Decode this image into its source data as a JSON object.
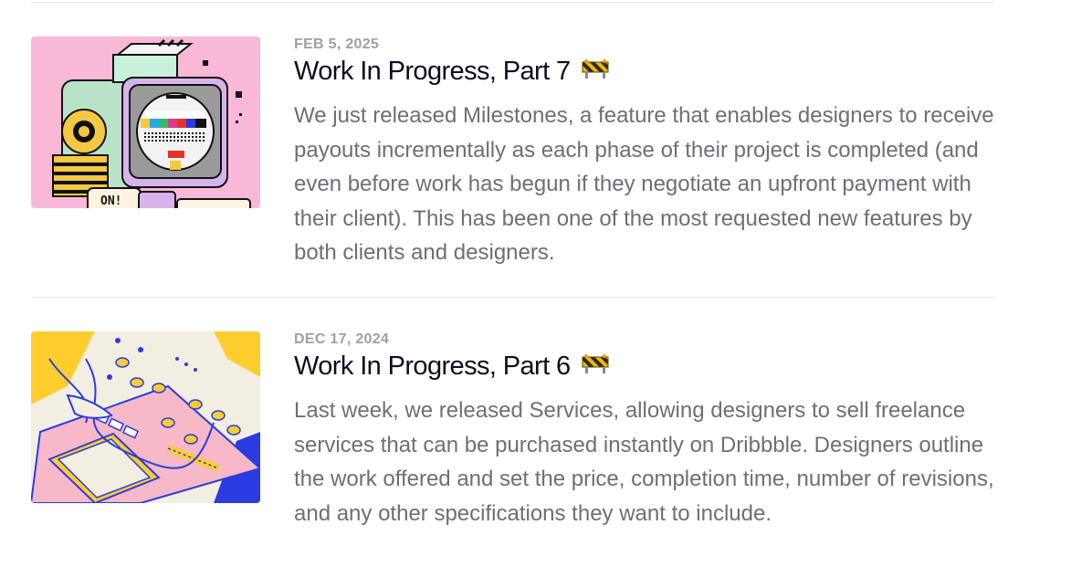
{
  "posts": [
    {
      "date": "FEB 5, 2025",
      "title": "Work In Progress, Part 7",
      "title_emoji": "construction-barrier-icon",
      "excerpt": "We just released Milestones, a feature that enables designers to receive payouts incrementally as each phase of their project is completed (and even before work has begun if they negotiate an upfront payment with their client). This has been one of the most requested new features by both clients and designers.",
      "thumbnail_badge": "ON!"
    },
    {
      "date": "DEC 17, 2024",
      "title": "Work In Progress, Part 6",
      "title_emoji": "construction-barrier-icon",
      "excerpt": "Last week, we released Services, allowing designers to sell freelance services that can be purchased instantly on Dribbble. Designers outline the work offered and set the price, completion time, number of revisions, and any other specifications they want to include."
    }
  ],
  "colors": {
    "title": "#0d0c22",
    "date": "#9e9ea7",
    "excerpt": "#6e6d7a",
    "divider": "#e7e7e9"
  }
}
